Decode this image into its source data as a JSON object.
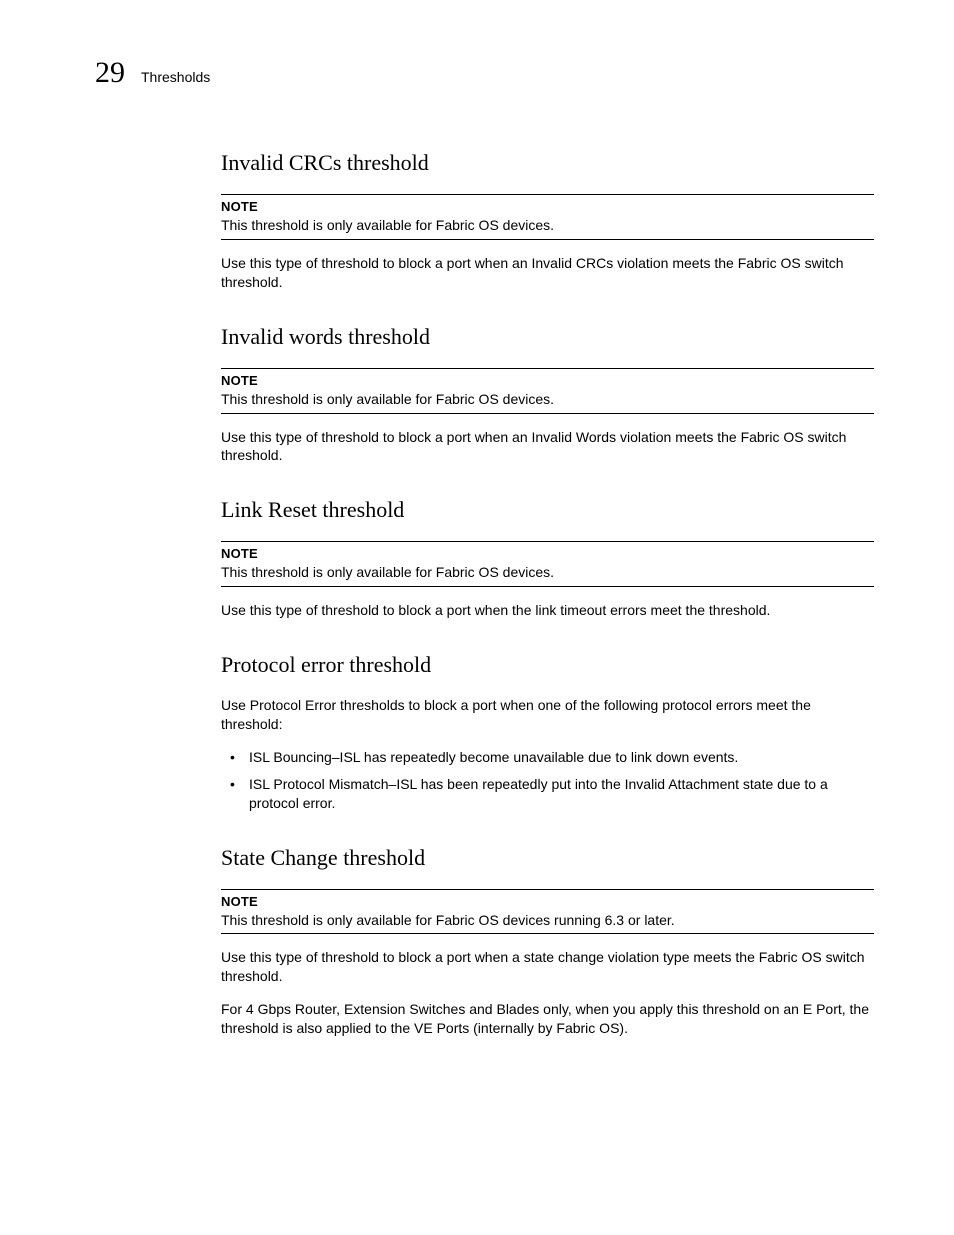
{
  "header": {
    "page_number": "29",
    "title": "Thresholds"
  },
  "note_label": "NOTE",
  "sections": {
    "s1": {
      "heading": "Invalid CRCs threshold",
      "note": "This threshold is only available for Fabric OS devices.",
      "body": "Use this type of threshold to block a port when an Invalid CRCs violation meets the Fabric OS switch threshold."
    },
    "s2": {
      "heading": "Invalid words threshold",
      "note": "This threshold is only available for Fabric OS devices.",
      "body": "Use this type of threshold to block a port when an Invalid Words violation meets the Fabric OS switch threshold."
    },
    "s3": {
      "heading": "Link Reset threshold",
      "note": "This threshold is only available for Fabric OS devices.",
      "body": "Use this type of threshold to block a port when the link timeout errors meet the threshold."
    },
    "s4": {
      "heading": "Protocol error threshold",
      "body": "Use Protocol Error thresholds to block a port when one of the following protocol errors meet the threshold:",
      "bullets": [
        "ISL Bouncing–ISL has repeatedly become unavailable due to link down events.",
        "ISL Protocol Mismatch–ISL has been repeatedly put into the Invalid Attachment state due to a protocol error."
      ]
    },
    "s5": {
      "heading": "State Change threshold",
      "note": "This threshold is only available for Fabric OS devices running 6.3 or later.",
      "body1": "Use this type of threshold to block a port when a state change violation type meets the Fabric OS switch threshold.",
      "body2": "For 4 Gbps Router, Extension Switches and Blades only, when you apply this threshold on an E Port, the threshold is also applied to the VE Ports (internally by Fabric OS)."
    }
  }
}
